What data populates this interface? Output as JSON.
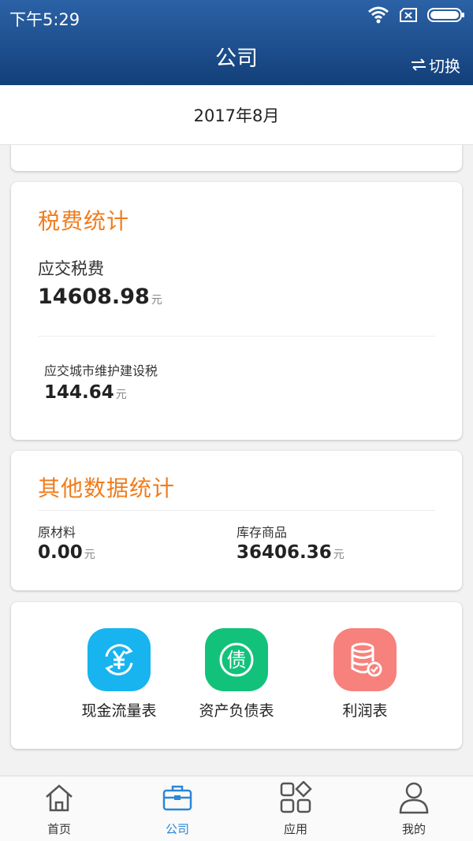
{
  "status_bar": {
    "time": "下午5:29"
  },
  "header": {
    "title": "公司",
    "switch_label": "切换"
  },
  "date": "2017年8月",
  "tax_stats": {
    "title": "税费统计",
    "total": {
      "label": "应交税费",
      "value": "14608.98",
      "unit": "元"
    },
    "urban_tax": {
      "label": "应交城市维护建设税",
      "value": "144.64",
      "unit": "元"
    }
  },
  "other_stats": {
    "title": "其他数据统计",
    "raw_materials": {
      "label": "原材料",
      "value": "0.00",
      "unit": "元"
    },
    "inventory": {
      "label": "库存商品",
      "value": "36406.36",
      "unit": "元"
    }
  },
  "reports": [
    {
      "label": "现金流量表",
      "icon": "cash-flow-icon",
      "color": "#18b4f0"
    },
    {
      "label": "资产负债表",
      "icon": "debt-icon",
      "color": "#12c27a"
    },
    {
      "label": "利润表",
      "icon": "database-check-icon",
      "color": "#f7817c"
    }
  ],
  "tabs": [
    {
      "label": "首页",
      "icon": "home-icon",
      "active": false
    },
    {
      "label": "公司",
      "icon": "briefcase-icon",
      "active": true
    },
    {
      "label": "应用",
      "icon": "apps-icon",
      "active": false
    },
    {
      "label": "我的",
      "icon": "user-icon",
      "active": false
    }
  ],
  "colors": {
    "accent_orange": "#f07c1c",
    "active_tab": "#2b86d6",
    "header_blue": "#1e4f8e"
  }
}
